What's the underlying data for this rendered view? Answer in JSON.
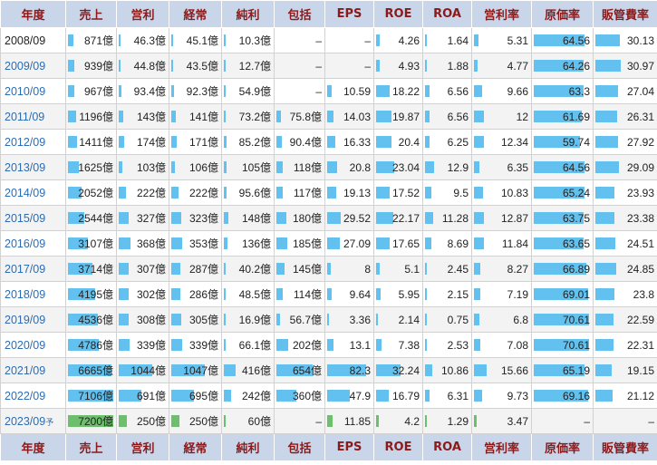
{
  "headers": [
    "年度",
    "売上",
    "営利",
    "経常",
    "純利",
    "包括",
    "EPS",
    "ROE",
    "ROA",
    "営利率",
    "原価率",
    "販管費率"
  ],
  "rows": [
    {
      "cells": [
        "2008/09",
        "871億",
        "46.3億",
        "45.1億",
        "10.3億",
        "–",
        "–",
        "4.26",
        "1.64",
        "5.31",
        "64.56",
        "30.13"
      ],
      "bars": [
        null,
        12,
        3,
        3,
        2,
        null,
        null,
        8,
        3,
        8,
        90,
        42
      ],
      "link": false,
      "forecast_mark": ""
    },
    {
      "cells": [
        "2009/09",
        "939億",
        "44.8億",
        "43.5億",
        "12.7億",
        "–",
        "–",
        "4.93",
        "1.88",
        "4.77",
        "64.26",
        "30.97"
      ],
      "bars": [
        null,
        13,
        3,
        3,
        2,
        null,
        null,
        9,
        3,
        7,
        89,
        43
      ],
      "link": true,
      "forecast_mark": ""
    },
    {
      "cells": [
        "2010/09",
        "967億",
        "93.4億",
        "92.3億",
        "54.9億",
        "–",
        "10.59",
        "18.22",
        "6.56",
        "9.66",
        "63.3",
        "27.04"
      ],
      "bars": [
        null,
        13,
        6,
        6,
        3,
        null,
        11,
        32,
        10,
        15,
        88,
        38
      ],
      "link": true,
      "forecast_mark": ""
    },
    {
      "cells": [
        "2011/09",
        "1196億",
        "143億",
        "141億",
        "73.2億",
        "75.8億",
        "14.03",
        "19.87",
        "6.56",
        "12",
        "61.69",
        "26.31"
      ],
      "bars": [
        null,
        17,
        10,
        10,
        4,
        9,
        15,
        35,
        10,
        18,
        86,
        37
      ],
      "link": true,
      "forecast_mark": ""
    },
    {
      "cells": [
        "2012/09",
        "1411億",
        "174億",
        "171億",
        "85.2億",
        "90.4億",
        "16.33",
        "20.4",
        "6.25",
        "12.34",
        "59.74",
        "27.92"
      ],
      "bars": [
        null,
        20,
        12,
        12,
        5,
        11,
        18,
        36,
        10,
        19,
        83,
        39
      ],
      "link": true,
      "forecast_mark": ""
    },
    {
      "cells": [
        "2013/09",
        "1625億",
        "103億",
        "106億",
        "105億",
        "118億",
        "20.8",
        "23.04",
        "12.9",
        "6.35",
        "64.56",
        "29.09"
      ],
      "bars": [
        null,
        23,
        7,
        7,
        6,
        14,
        23,
        41,
        21,
        10,
        90,
        40
      ],
      "link": true,
      "forecast_mark": ""
    },
    {
      "cells": [
        "2014/09",
        "2052億",
        "222億",
        "222億",
        "95.6億",
        "117億",
        "19.13",
        "17.52",
        "9.5",
        "10.83",
        "65.24",
        "23.93"
      ],
      "bars": [
        null,
        29,
        15,
        15,
        6,
        14,
        21,
        31,
        15,
        16,
        91,
        33
      ],
      "link": true,
      "forecast_mark": ""
    },
    {
      "cells": [
        "2015/09",
        "2544億",
        "327億",
        "323億",
        "148億",
        "180億",
        "29.52",
        "22.17",
        "11.28",
        "12.87",
        "63.75",
        "23.38"
      ],
      "bars": [
        null,
        36,
        22,
        22,
        9,
        22,
        32,
        39,
        18,
        19,
        89,
        32
      ],
      "link": true,
      "forecast_mark": ""
    },
    {
      "cells": [
        "2016/09",
        "3107億",
        "368億",
        "353億",
        "136億",
        "185億",
        "27.09",
        "17.65",
        "8.69",
        "11.84",
        "63.65",
        "24.51"
      ],
      "bars": [
        null,
        44,
        25,
        24,
        8,
        23,
        30,
        31,
        14,
        18,
        89,
        34
      ],
      "link": true,
      "forecast_mark": ""
    },
    {
      "cells": [
        "2017/09",
        "3714億",
        "307億",
        "287億",
        "40.2億",
        "145億",
        "8",
        "5.1",
        "2.45",
        "8.27",
        "66.89",
        "24.85"
      ],
      "bars": [
        null,
        53,
        21,
        20,
        2,
        18,
        9,
        9,
        4,
        12,
        93,
        35
      ],
      "link": true,
      "forecast_mark": ""
    },
    {
      "cells": [
        "2018/09",
        "4195億",
        "302億",
        "286億",
        "48.5億",
        "114億",
        "9.64",
        "5.95",
        "2.15",
        "7.19",
        "69.01",
        "23.8"
      ],
      "bars": [
        null,
        60,
        21,
        20,
        3,
        14,
        11,
        10,
        3,
        11,
        96,
        33
      ],
      "link": true,
      "forecast_mark": ""
    },
    {
      "cells": [
        "2019/09",
        "4536億",
        "308億",
        "305億",
        "16.9億",
        "56.7億",
        "3.36",
        "2.14",
        "0.75",
        "6.8",
        "70.61",
        "22.59"
      ],
      "bars": [
        null,
        65,
        21,
        21,
        1,
        7,
        4,
        4,
        1,
        10,
        98,
        31
      ],
      "link": true,
      "forecast_mark": ""
    },
    {
      "cells": [
        "2020/09",
        "4786億",
        "339億",
        "339億",
        "66.1億",
        "202億",
        "13.1",
        "7.38",
        "2.53",
        "7.08",
        "70.61",
        "22.31"
      ],
      "bars": [
        null,
        68,
        23,
        23,
        4,
        25,
        14,
        13,
        4,
        11,
        98,
        31
      ],
      "link": true,
      "forecast_mark": ""
    },
    {
      "cells": [
        "2021/09",
        "6665億",
        "1044億",
        "1047億",
        "416億",
        "654億",
        "82.3",
        "32.24",
        "10.86",
        "15.66",
        "65.19",
        "19.15"
      ],
      "bars": [
        null,
        95,
        72,
        72,
        25,
        80,
        90,
        57,
        17,
        24,
        91,
        27
      ],
      "link": true,
      "forecast_mark": ""
    },
    {
      "cells": [
        "2022/09",
        "7106億",
        "691億",
        "695億",
        "242億",
        "360億",
        "47.9",
        "16.79",
        "6.31",
        "9.73",
        "69.16",
        "21.12"
      ],
      "bars": [
        null,
        100,
        48,
        48,
        15,
        44,
        53,
        30,
        10,
        15,
        96,
        29
      ],
      "link": true,
      "forecast_mark": ""
    },
    {
      "cells": [
        "2023/09",
        "7200億",
        "250億",
        "250億",
        "60億",
        "–",
        "11.85",
        "4.2",
        "1.29",
        "3.47",
        "–",
        "–"
      ],
      "bars": [
        null,
        100,
        17,
        17,
        4,
        null,
        13,
        7,
        2,
        5,
        null,
        null
      ],
      "link": true,
      "forecast_mark": "予",
      "forecast": true
    }
  ],
  "colors": {
    "header_bg": "#c9d6ea",
    "header_text": "#8b1a1a",
    "bar_blue": "#62c1ee",
    "bar_green": "#6dbf6d",
    "link": "#2a6db5"
  }
}
